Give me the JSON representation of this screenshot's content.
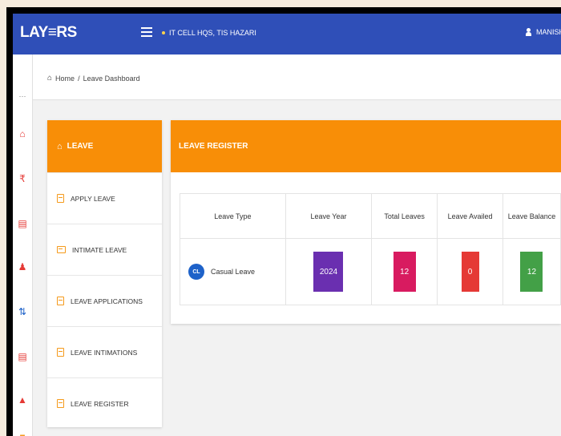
{
  "app": {
    "logo": "LAY≡RS",
    "org": "IT CELL HQS, TIS HAZARI",
    "user": "MANISH"
  },
  "breadcrumb": {
    "home": "Home",
    "separator": "/",
    "current": "Leave Dashboard"
  },
  "leave_menu": {
    "header": "LEAVE",
    "items": [
      {
        "label": "APPLY LEAVE",
        "icon": "document-icon"
      },
      {
        "label": "INTIMATE LEAVE",
        "icon": "envelope-icon"
      },
      {
        "label": "LEAVE APPLICATIONS",
        "icon": "document-icon"
      },
      {
        "label": "LEAVE INTIMATIONS",
        "icon": "document-icon"
      },
      {
        "label": "LEAVE REGISTER",
        "icon": "document-icon"
      }
    ]
  },
  "register": {
    "title": "LEAVE REGISTER",
    "columns": [
      "Leave Type",
      "Leave Year",
      "Total Leaves",
      "Leave Availed",
      "Leave Balance"
    ],
    "rows": [
      {
        "badge": "CL",
        "type": "Casual Leave",
        "year": "2024",
        "total": "12",
        "availed": "0",
        "balance": "12"
      }
    ]
  },
  "colors": {
    "topbar": "#2f4fb8",
    "accent": "#f88e07",
    "year_box": "#6a2fb0",
    "total_box": "#d81b60",
    "availed_box": "#e53935",
    "balance_box": "#43a047",
    "badge": "#1e62c9"
  },
  "rail_icons": [
    "dots-icon",
    "home-icon",
    "rupee-icon",
    "calendar-icon",
    "users-icon",
    "transfer-icon",
    "list-icon",
    "bank-icon",
    "folder-icon"
  ]
}
